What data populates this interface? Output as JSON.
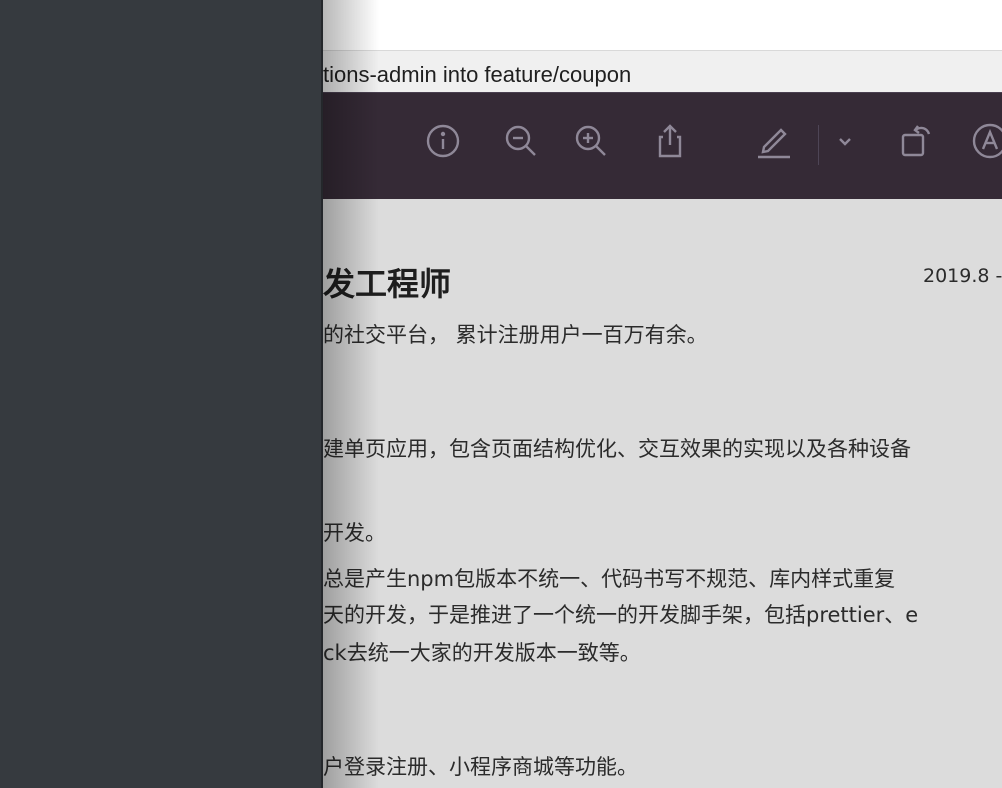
{
  "commit_bar": {
    "text": "tions-admin into feature/coupon"
  },
  "toolbar": {
    "icons": [
      "info-icon",
      "zoom-out-icon",
      "zoom-in-icon",
      "share-icon",
      "markup-pen-icon",
      "chevron-down-icon",
      "rotate-icon",
      "annotate-icon"
    ]
  },
  "document": {
    "job_title": "发工程师",
    "date": "2019.8 -",
    "lines": [
      "的社交平台， 累计注册用户一百万有余。",
      "建单页应用，包含页面结构优化、交互效果的实现以及各种设备",
      "开发。",
      "   总是产生npm包版本不统一、代码书写不规范、库内样式重复",
      "天的开发，于是推进了一个统一的开发脚手架，包括prettier、e",
      "ck去统一大家的开发版本一致等。",
      "户登录注册、小程序商城等功能。"
    ]
  },
  "colors": {
    "left_panel": "#363a3f",
    "toolbar": "#352a36",
    "document_bg": "#dcdcdc"
  }
}
